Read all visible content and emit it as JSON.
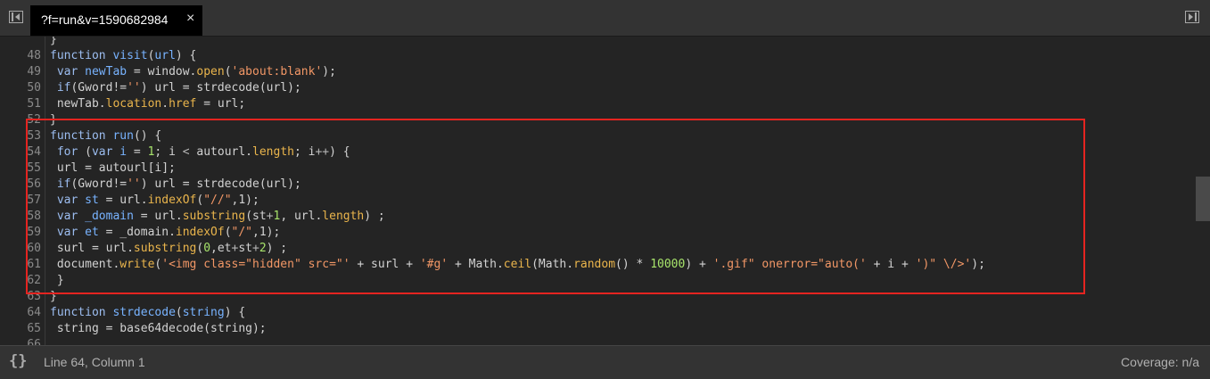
{
  "tab": {
    "title": "?f=run&v=1590682984",
    "close_glyph": "×"
  },
  "status": {
    "pretty_print": "{}",
    "position": "Line 64, Column 1",
    "coverage": "Coverage: n/a"
  },
  "code_lines": [
    {
      "num": "",
      "tokens": [
        [
          "}",
          "p"
        ]
      ]
    },
    {
      "num": "48",
      "tokens": [
        [
          "function",
          "kw"
        ],
        [
          " ",
          "p"
        ],
        [
          "visit",
          "def"
        ],
        [
          "(",
          "p"
        ],
        [
          "url",
          "def"
        ],
        [
          ") {",
          "p"
        ]
      ]
    },
    {
      "num": "49",
      "tokens": [
        [
          " ",
          "p"
        ],
        [
          "var",
          "kw"
        ],
        [
          " ",
          "p"
        ],
        [
          "newTab",
          "def"
        ],
        [
          " = window.",
          "p"
        ],
        [
          "open",
          "prop"
        ],
        [
          "(",
          "p"
        ],
        [
          "'about:blank'",
          "str"
        ],
        [
          ");",
          "p"
        ]
      ]
    },
    {
      "num": "50",
      "tokens": [
        [
          " ",
          "p"
        ],
        [
          "if",
          "kw"
        ],
        [
          "(Gword!=",
          "p"
        ],
        [
          "''",
          "str"
        ],
        [
          ") url = strdecode(url);",
          "p"
        ]
      ]
    },
    {
      "num": "51",
      "tokens": [
        [
          " newTab.",
          "p"
        ],
        [
          "location",
          "prop"
        ],
        [
          ".",
          "p"
        ],
        [
          "href",
          "prop"
        ],
        [
          " = url;",
          "p"
        ]
      ]
    },
    {
      "num": "52",
      "tokens": [
        [
          "}",
          "p"
        ]
      ]
    },
    {
      "num": "53",
      "tokens": [
        [
          "function",
          "kw"
        ],
        [
          " ",
          "p"
        ],
        [
          "run",
          "def"
        ],
        [
          "() {",
          "p"
        ]
      ]
    },
    {
      "num": "54",
      "tokens": [
        [
          " ",
          "p"
        ],
        [
          "for",
          "kw"
        ],
        [
          " (",
          "p"
        ],
        [
          "var",
          "kw"
        ],
        [
          " ",
          "p"
        ],
        [
          "i",
          "def"
        ],
        [
          " = ",
          "p"
        ],
        [
          "1",
          "num"
        ],
        [
          "; i ",
          "p"
        ],
        [
          "<",
          "op"
        ],
        [
          " autourl.",
          "p"
        ],
        [
          "length",
          "prop"
        ],
        [
          "; i",
          "p"
        ],
        [
          "++",
          "op"
        ],
        [
          ") {",
          "p"
        ]
      ]
    },
    {
      "num": "55",
      "tokens": [
        [
          " url = autourl[i];",
          "p"
        ]
      ]
    },
    {
      "num": "56",
      "tokens": [
        [
          " ",
          "p"
        ],
        [
          "if",
          "kw"
        ],
        [
          "(Gword!=",
          "p"
        ],
        [
          "''",
          "str"
        ],
        [
          ") url = strdecode(url);",
          "p"
        ]
      ]
    },
    {
      "num": "57",
      "tokens": [
        [
          " ",
          "p"
        ],
        [
          "var",
          "kw"
        ],
        [
          " ",
          "p"
        ],
        [
          "st",
          "def"
        ],
        [
          " = url.",
          "p"
        ],
        [
          "indexOf",
          "prop"
        ],
        [
          "(",
          "p"
        ],
        [
          "\"//\"",
          "str"
        ],
        [
          ",1);",
          "p"
        ]
      ]
    },
    {
      "num": "58",
      "tokens": [
        [
          " ",
          "p"
        ],
        [
          "var",
          "kw"
        ],
        [
          " ",
          "p"
        ],
        [
          "_domain",
          "def"
        ],
        [
          " = url.",
          "p"
        ],
        [
          "substring",
          "prop"
        ],
        [
          "(st",
          "p"
        ],
        [
          "+",
          "op"
        ],
        [
          "1",
          "num"
        ],
        [
          ", url.",
          "p"
        ],
        [
          "length",
          "prop"
        ],
        [
          ") ;",
          "p"
        ]
      ]
    },
    {
      "num": "59",
      "tokens": [
        [
          " ",
          "p"
        ],
        [
          "var",
          "kw"
        ],
        [
          " ",
          "p"
        ],
        [
          "et",
          "def"
        ],
        [
          " = _domain.",
          "p"
        ],
        [
          "indexOf",
          "prop"
        ],
        [
          "(",
          "p"
        ],
        [
          "\"/\"",
          "str"
        ],
        [
          ",1);",
          "p"
        ]
      ]
    },
    {
      "num": "60",
      "tokens": [
        [
          " surl = url.",
          "p"
        ],
        [
          "substring",
          "prop"
        ],
        [
          "(",
          "p"
        ],
        [
          "0",
          "num"
        ],
        [
          ",et",
          "p"
        ],
        [
          "+",
          "op"
        ],
        [
          "st",
          "p"
        ],
        [
          "+",
          "op"
        ],
        [
          "2",
          "num"
        ],
        [
          ") ;",
          "p"
        ]
      ]
    },
    {
      "num": "61",
      "tokens": [
        [
          " document.",
          "p"
        ],
        [
          "write",
          "prop"
        ],
        [
          "(",
          "p"
        ],
        [
          "'<img class=\"hidden\" src=\"'",
          "str"
        ],
        [
          " + surl + ",
          "p"
        ],
        [
          "'#g'",
          "str"
        ],
        [
          " + Math.",
          "p"
        ],
        [
          "ceil",
          "prop"
        ],
        [
          "(Math.",
          "p"
        ],
        [
          "random",
          "prop"
        ],
        [
          "() * ",
          "p"
        ],
        [
          "10000",
          "num"
        ],
        [
          ") + ",
          "p"
        ],
        [
          "'.gif\" onerror=\"auto('",
          "str"
        ],
        [
          " + i + ",
          "p"
        ],
        [
          "')\" \\/>'",
          "str"
        ],
        [
          ");",
          "p"
        ]
      ]
    },
    {
      "num": "62",
      "tokens": [
        [
          " }",
          "p"
        ]
      ]
    },
    {
      "num": "63",
      "tokens": [
        [
          "}",
          "p"
        ]
      ]
    },
    {
      "num": "64",
      "tokens": [
        [
          "function",
          "kw"
        ],
        [
          " ",
          "p"
        ],
        [
          "strdecode",
          "def"
        ],
        [
          "(",
          "p"
        ],
        [
          "string",
          "def"
        ],
        [
          ") {",
          "p"
        ]
      ]
    },
    {
      "num": "65",
      "tokens": [
        [
          " string = base64decode(string);",
          "p"
        ]
      ]
    },
    {
      "num": "66",
      "tokens": [
        [
          "",
          "p"
        ]
      ]
    }
  ],
  "colors": {
    "background": "#242424",
    "keyword": "#9cbdf0",
    "definition": "#78b3ff",
    "property": "#eab54c",
    "string": "#f29766",
    "number": "#a7e36b",
    "highlight_border": "#e52420"
  }
}
